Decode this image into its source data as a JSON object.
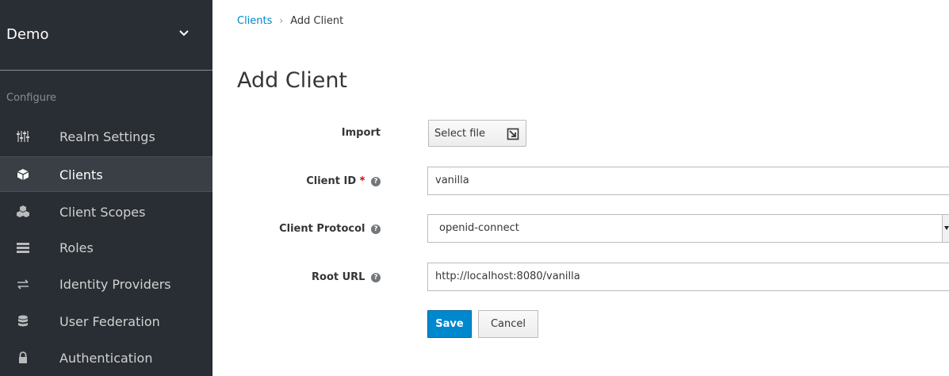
{
  "sidebar": {
    "realm": "Demo",
    "section": "Configure",
    "items": [
      {
        "label": "Realm Settings",
        "icon": "sliders-icon"
      },
      {
        "label": "Clients",
        "icon": "cube-icon",
        "active": true
      },
      {
        "label": "Client Scopes",
        "icon": "cubes-icon"
      },
      {
        "label": "Roles",
        "icon": "list-icon"
      },
      {
        "label": "Identity Providers",
        "icon": "exchange-icon"
      },
      {
        "label": "User Federation",
        "icon": "database-icon"
      },
      {
        "label": "Authentication",
        "icon": "lock-icon"
      }
    ]
  },
  "breadcrumb": {
    "parent": "Clients",
    "separator": "›",
    "current": "Add Client"
  },
  "page": {
    "title": "Add Client"
  },
  "form": {
    "import": {
      "label": "Import",
      "button": "Select file"
    },
    "client_id": {
      "label": "Client ID",
      "required": "*",
      "value": "vanilla"
    },
    "client_protocol": {
      "label": "Client Protocol",
      "value": "openid-connect"
    },
    "root_url": {
      "label": "Root URL",
      "value": "http://localhost:8080/vanilla"
    },
    "help": "?"
  },
  "actions": {
    "save": "Save",
    "cancel": "Cancel"
  },
  "colors": {
    "sidebar_bg": "#292e34",
    "active_bg": "#393f44",
    "primary": "#0088ce",
    "required": "#cc0000"
  }
}
